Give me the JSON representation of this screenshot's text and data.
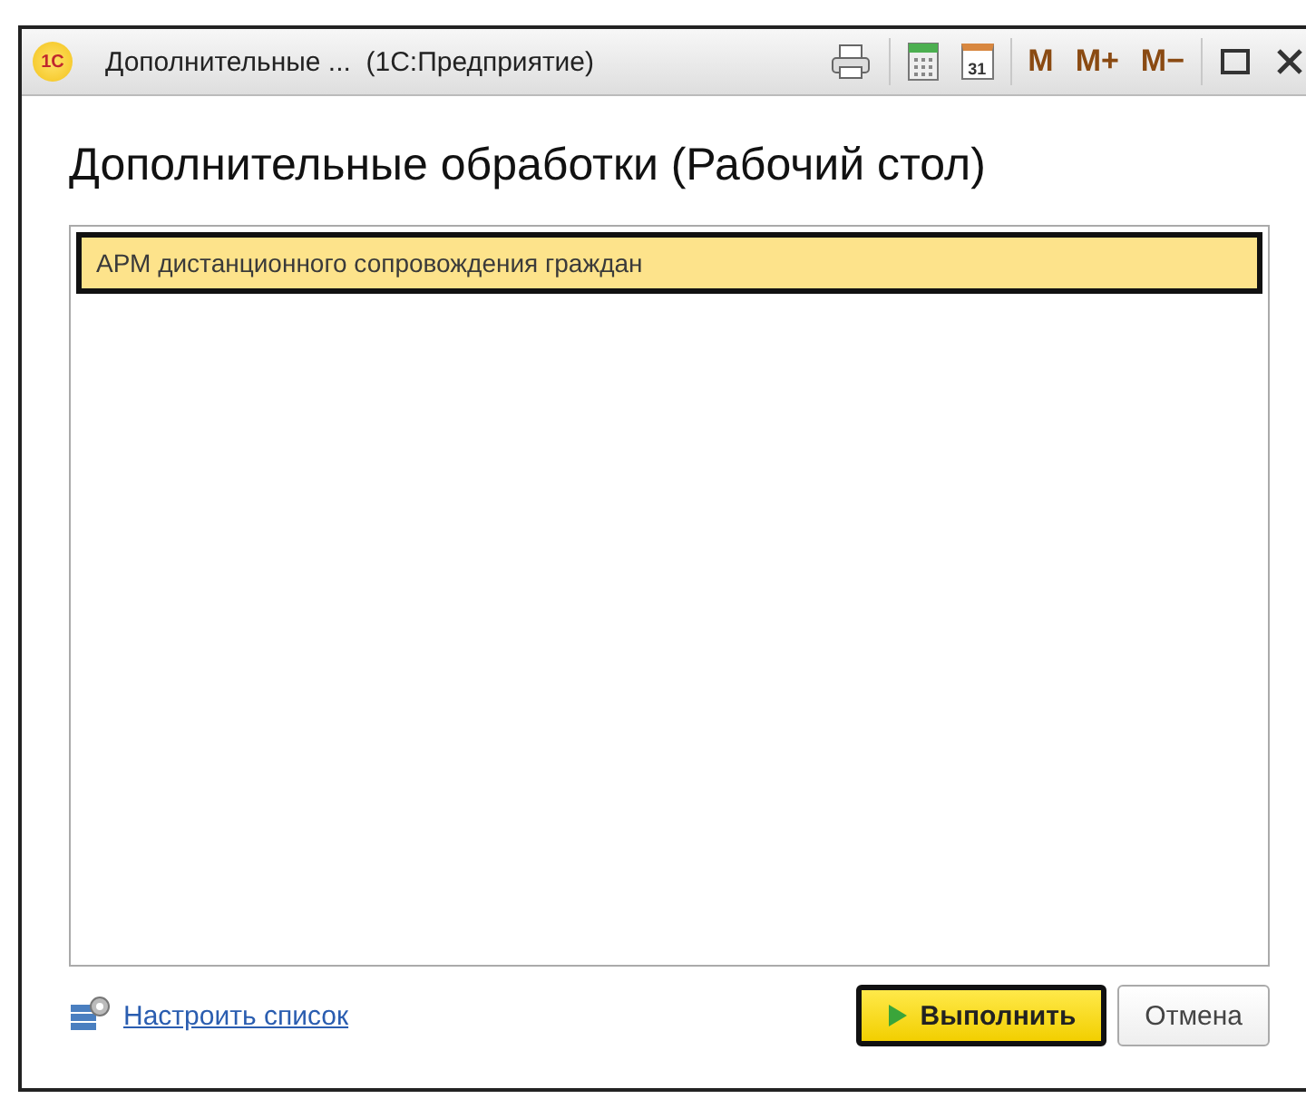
{
  "window": {
    "logo": "1С",
    "title": "Дополнительные ...  (1С:Предприятие)",
    "toolbar": [
      {
        "kind": "print"
      },
      {
        "kind": "calculator"
      },
      {
        "kind": "calendar",
        "label": "31"
      },
      {
        "kind": "text",
        "label": "M"
      },
      {
        "kind": "text",
        "label": "M+"
      },
      {
        "kind": "text",
        "label": "M−"
      },
      {
        "kind": "maximize"
      },
      {
        "kind": "close"
      }
    ]
  },
  "heading": "Дополнительные обработки (Рабочий стол)",
  "list": {
    "items": [
      {
        "label": "АРМ дистанционного сопровождения граждан",
        "selected": true
      }
    ]
  },
  "footer": {
    "link": "Настроить список",
    "buttons": [
      {
        "label": "Выполнить",
        "kind": "primary"
      },
      {
        "label": "Отмена",
        "kind": "secondary"
      }
    ]
  }
}
